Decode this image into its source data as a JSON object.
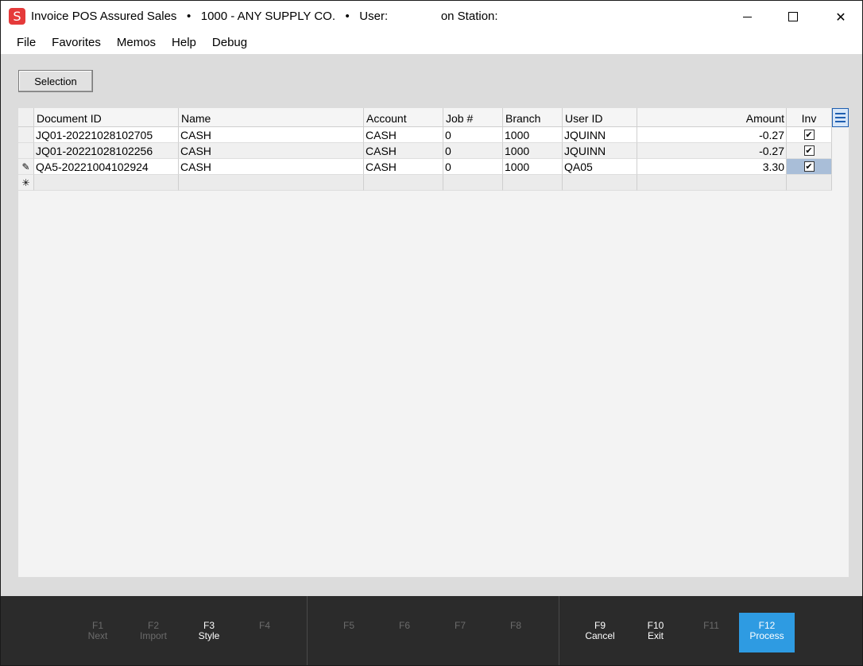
{
  "window": {
    "app_icon": "S",
    "title": "Invoice POS Assured Sales",
    "sep": "•",
    "company": "1000 - ANY SUPPLY CO.",
    "user_label": "User:",
    "station_label": "on Station:",
    "min_icon": "minimize-icon",
    "max_icon": "maximize-icon",
    "close_icon": "close-icon",
    "close_glyph": "✕"
  },
  "menu": [
    "File",
    "Favorites",
    "Memos",
    "Help",
    "Debug"
  ],
  "selection_button": "Selection",
  "grid": {
    "columns": [
      "Document ID",
      "Name",
      "Account",
      "Job #",
      "Branch",
      "User ID",
      "Amount",
      "Inv"
    ],
    "rows": [
      {
        "indicator": "",
        "document_id": "JQ01-20221028102705",
        "name": "CASH",
        "account": "CASH",
        "job": "0",
        "branch": "1000",
        "user_id": "JQUINN",
        "amount": "-0.27",
        "inv": "✔"
      },
      {
        "indicator": "",
        "document_id": "JQ01-20221028102256",
        "name": "CASH",
        "account": "CASH",
        "job": "0",
        "branch": "1000",
        "user_id": "JQUINN",
        "amount": "-0.27",
        "inv": "✔"
      },
      {
        "indicator": "✎",
        "document_id": "QA5-20221004102924",
        "name": "CASH",
        "account": "CASH",
        "job": "0",
        "branch": "1000",
        "user_id": "QA05",
        "amount": "3.30",
        "inv": "✔"
      }
    ],
    "new_row_indicator": "✳",
    "column_menu_icon": "hamburger-menu-icon"
  },
  "footer": {
    "keys": [
      {
        "key": "F1",
        "label": "Next",
        "enabled": false
      },
      {
        "key": "F2",
        "label": "Import",
        "enabled": false
      },
      {
        "key": "F3",
        "label": "Style",
        "enabled": true
      },
      {
        "key": "F4",
        "label": "",
        "enabled": false
      },
      {
        "key": "F5",
        "label": "",
        "enabled": false
      },
      {
        "key": "F6",
        "label": "",
        "enabled": false
      },
      {
        "key": "F7",
        "label": "",
        "enabled": false
      },
      {
        "key": "F8",
        "label": "",
        "enabled": false
      },
      {
        "key": "F9",
        "label": "Cancel",
        "enabled": true
      },
      {
        "key": "F10",
        "label": "Exit",
        "enabled": true
      },
      {
        "key": "F11",
        "label": "",
        "enabled": false
      },
      {
        "key": "F12",
        "label": "Process",
        "enabled": true
      }
    ],
    "accent_color": "#2e9be2"
  }
}
